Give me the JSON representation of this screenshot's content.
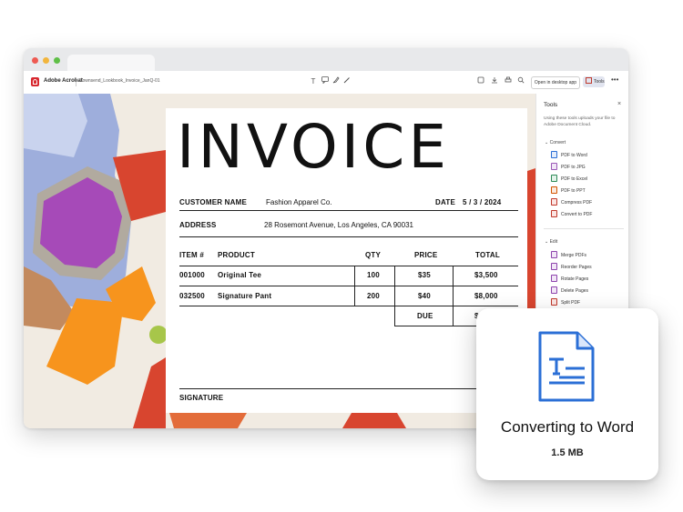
{
  "toolbar": {
    "brand": "Adobe Acrobat",
    "filename": "Townsend_Lookbook_Invoice_JanQ-01",
    "open_desktop": "Open in desktop app",
    "tools": "Tools",
    "more": "•••"
  },
  "invoice": {
    "title": "INVOICE",
    "customer_label": "CUSTOMER NAME",
    "customer_value": "Fashion Apparel Co.",
    "date_label": "DATE",
    "date_value": "5 / 3 / 2024",
    "address_label": "ADDRESS",
    "address_value": "28 Rosemont Avenue, Los Angeles, CA 90031",
    "headers": {
      "item": "ITEM #",
      "product": "PRODUCT",
      "qty": "QTY",
      "price": "PRICE",
      "total": "TOTAL"
    },
    "rows": [
      {
        "item": "001000",
        "product": "Original Tee",
        "qty": "100",
        "price": "$35",
        "total": "$3,500"
      },
      {
        "item": "032500",
        "product": "Signature Pant",
        "qty": "200",
        "price": "$40",
        "total": "$8,000"
      }
    ],
    "due_label": "DUE",
    "due_value": "$1",
    "signature_label": "SIGNATURE"
  },
  "sidebar": {
    "title": "Tools",
    "close": "×",
    "note": "Using these tools uploads your file to Adobe Document Cloud.",
    "convert_label": "Convert",
    "convert_items": [
      "PDF to Word",
      "PDF to JPG",
      "PDF to Excel",
      "PDF to PPT",
      "Compress PDF",
      "Convert to PDF"
    ],
    "edit_label": "Edit",
    "edit_items": [
      "Merge PDFs",
      "Reorder Pages",
      "Rotate Pages",
      "Delete Pages",
      "Split PDF"
    ]
  },
  "card": {
    "title": "Converting to Word",
    "size": "1.5 MB"
  },
  "colors": {
    "acrobat_red": "#d7282f",
    "word_blue": "#2b6fd6",
    "selected_tools_bg": "#e1e4ef"
  }
}
